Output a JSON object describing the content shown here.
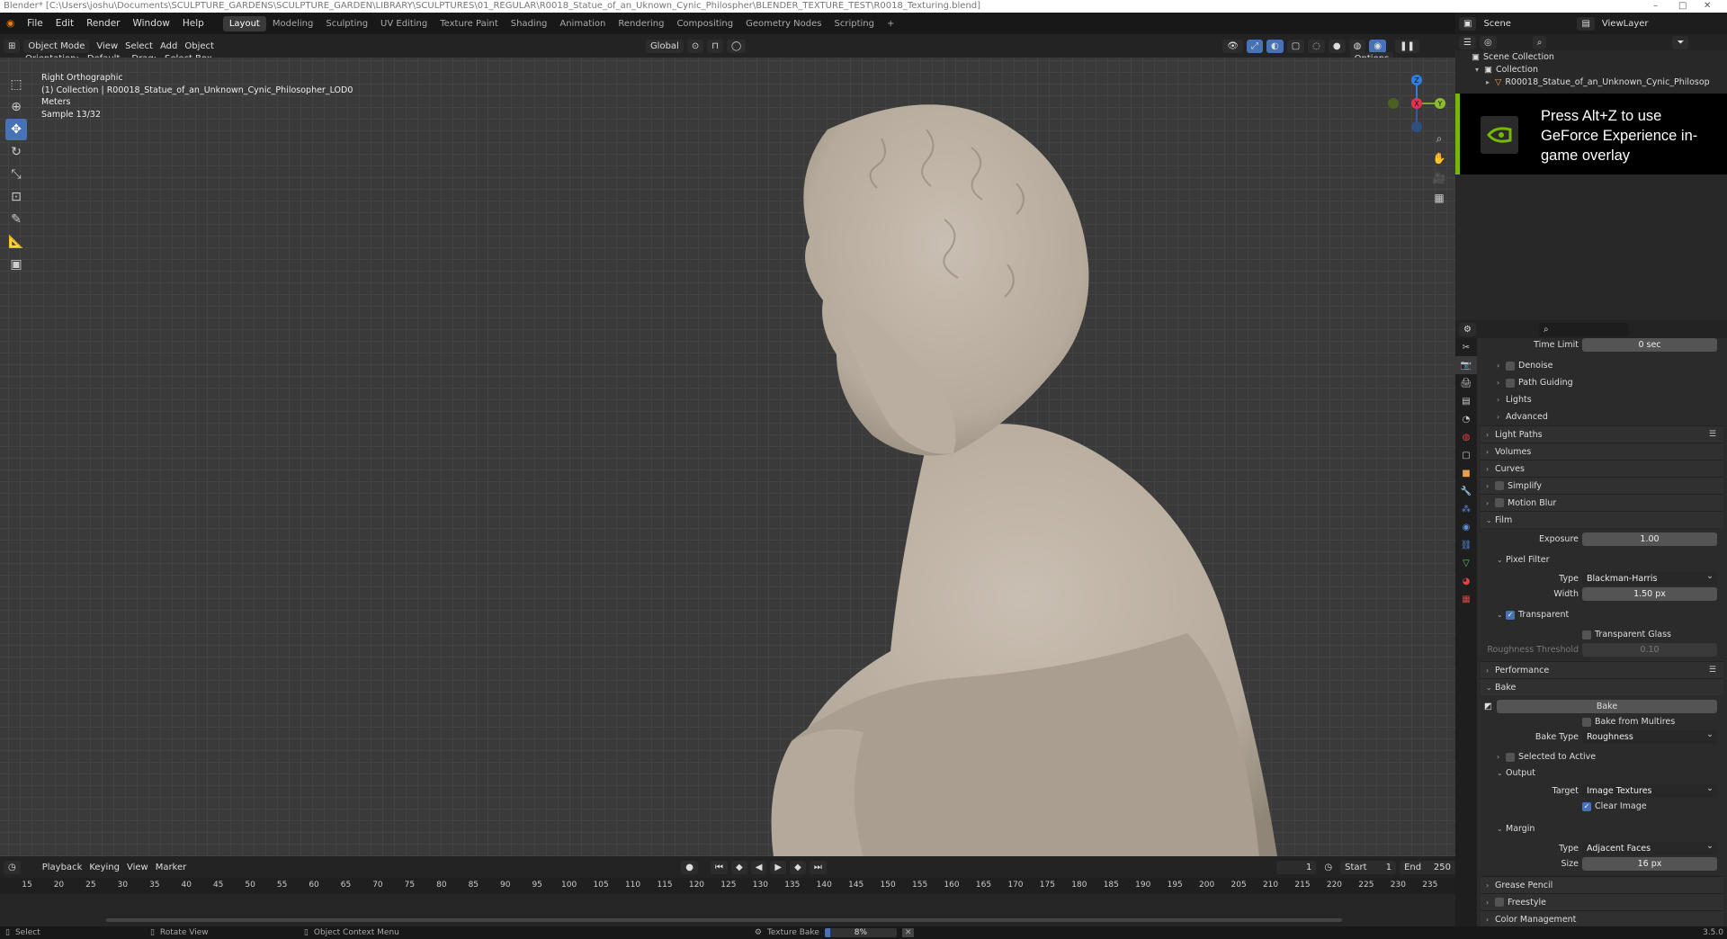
{
  "window": {
    "title": "Blender* [C:\\Users\\joshu\\Documents\\SCULPTURE_GARDENS\\SCULPTURE_GARDEN\\LIBRARY\\SCULPTURES\\01_REGULAR\\R0018_Statue_of_an_Uknown_Cynic_Philospher\\BLENDER_TEXTURE_TEST\\R0018_Texturing.blend]",
    "minimize": "–",
    "maximize": "□",
    "close": "✕"
  },
  "menu": [
    "File",
    "Edit",
    "Render",
    "Window",
    "Help"
  ],
  "workspaces": [
    "Layout",
    "Modeling",
    "Sculpting",
    "UV Editing",
    "Texture Paint",
    "Shading",
    "Animation",
    "Rendering",
    "Compositing",
    "Geometry Nodes",
    "Scripting"
  ],
  "active_workspace": "Layout",
  "add_workspace": "+",
  "viewport_header": {
    "mode": "Object Mode",
    "menus": [
      "View",
      "Select",
      "Add",
      "Object"
    ],
    "transform": "Global",
    "options": "Options",
    "orientation_label": "Orientation:",
    "orientation_value": "Default",
    "drag_label": "Drag:",
    "drag_value": "Select Box"
  },
  "viewport_info": {
    "view": "Right Orthographic",
    "collection": "(1) Collection | R00018_Statue_of_an_Unknown_Cynic_Philosopher_LOD0",
    "units": "Meters",
    "sample": "Sample 13/32"
  },
  "gizmo": {
    "z": "Z",
    "y": "Y",
    "x": "X"
  },
  "timeline": {
    "menus": [
      "Playback",
      "Keying",
      "View",
      "Marker"
    ],
    "current_frame": "1",
    "start_label": "Start",
    "start": "1",
    "end_label": "End",
    "end": "250",
    "ticks": [
      "15",
      "20",
      "25",
      "30",
      "35",
      "40",
      "45",
      "50",
      "55",
      "60",
      "65",
      "70",
      "75",
      "80",
      "85",
      "90",
      "95",
      "100",
      "105",
      "110",
      "115",
      "120",
      "125",
      "130",
      "135",
      "140",
      "145",
      "150",
      "155",
      "160",
      "165",
      "170",
      "175",
      "180",
      "185",
      "190",
      "195",
      "200",
      "205",
      "210",
      "215",
      "220",
      "225",
      "230",
      "235"
    ]
  },
  "statusbar": {
    "select": "Select",
    "rotate": "Rotate View",
    "context": "Object Context Menu",
    "bake_label": "Texture Bake",
    "bake_progress_text": "8%",
    "bake_progress": 0.08,
    "version": "3.5.0"
  },
  "outliner": {
    "scene": "Scene",
    "view_layer": "ViewLayer",
    "rows": [
      "Scene Collection",
      "Collection",
      "R00018_Statue_of_an_Unknown_Cynic_Philosop"
    ]
  },
  "geforce": {
    "text": "Press Alt+Z to use GeForce Experience in-game overlay"
  },
  "properties": {
    "time_limit_label": "Time Limit",
    "time_limit_value": "0 sec",
    "denoise": "Denoise",
    "path_guiding": "Path Guiding",
    "lights": "Lights",
    "advanced": "Advanced",
    "light_paths": "Light Paths",
    "volumes": "Volumes",
    "curves": "Curves",
    "simplify": "Simplify",
    "motion_blur": "Motion Blur",
    "film": "Film",
    "exposure_label": "Exposure",
    "exposure_value": "1.00",
    "pixel_filter": "Pixel Filter",
    "type_label": "Type",
    "type_value": "Blackman-Harris",
    "width_label": "Width",
    "width_value": "1.50 px",
    "transparent": "Transparent",
    "transparent_glass": "Transparent Glass",
    "roughness_threshold_label": "Roughness Threshold",
    "roughness_threshold_value": "0.10",
    "performance": "Performance",
    "bake": "Bake",
    "bake_button": "Bake",
    "bake_from_multires": "Bake from Multires",
    "bake_type_label": "Bake Type",
    "bake_type_value": "Roughness",
    "selected_to_active": "Selected to Active",
    "output": "Output",
    "target_label": "Target",
    "target_value": "Image Textures",
    "clear_image": "Clear Image",
    "margin": "Margin",
    "margin_type_label": "Type",
    "margin_type_value": "Adjacent Faces",
    "size_label": "Size",
    "size_value": "16 px",
    "grease_pencil": "Grease Pencil",
    "freestyle": "Freestyle",
    "color_management": "Color Management"
  }
}
